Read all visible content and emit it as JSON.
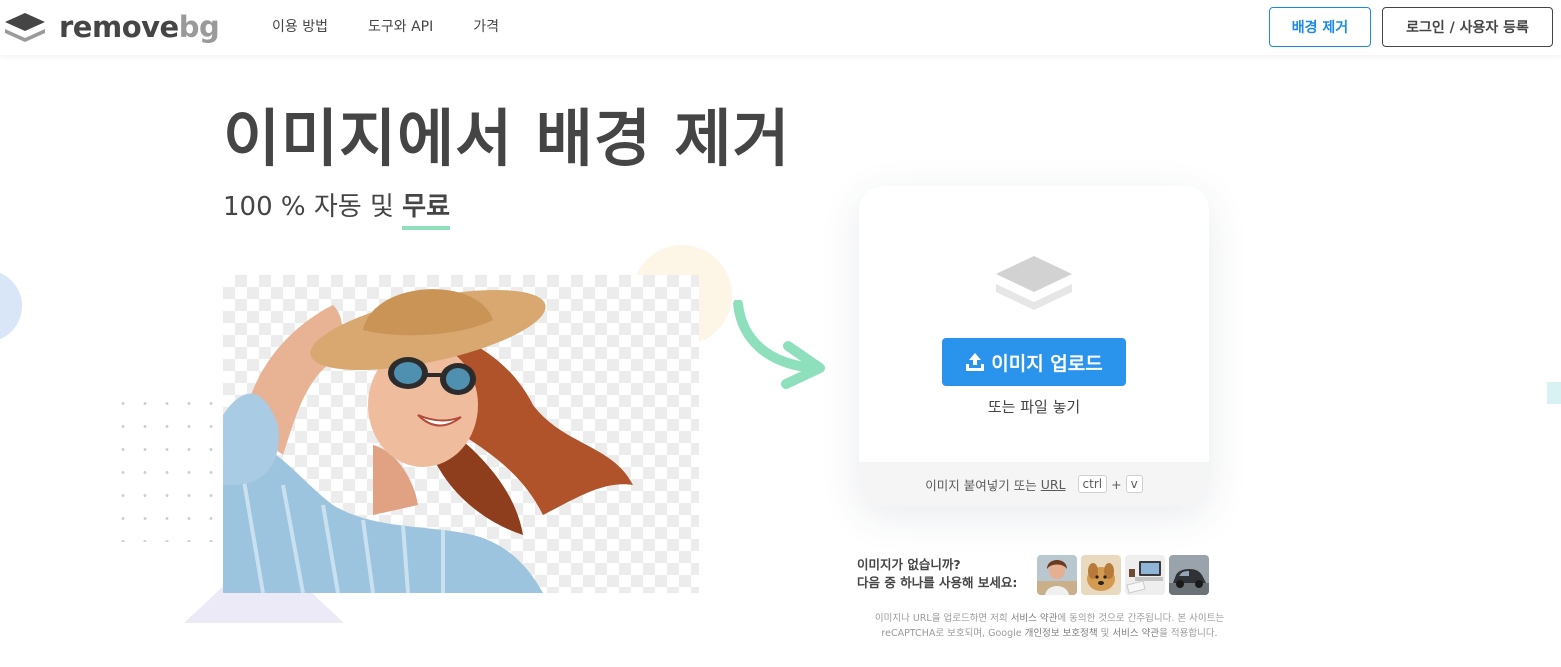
{
  "header": {
    "logo": {
      "part1": "remove",
      "part2": "bg"
    },
    "nav": [
      "이용 방법",
      "도구와 API",
      "가격"
    ],
    "remove_bg_button": "배경 제거",
    "login_button": "로그인 / 사용자 등록"
  },
  "hero": {
    "title": "이미지에서 배경 제거",
    "subtitle_prefix": "100 % 자동 및",
    "subtitle_highlight": "무료"
  },
  "upload": {
    "button_label": "이미지 업로드",
    "drop_text": "또는 파일 놓기",
    "paste_text": "이미지 붙여넣기 또는",
    "url_link": "URL",
    "key_ctrl": "ctrl",
    "key_plus": "+",
    "key_v": "v"
  },
  "samples": {
    "question_line1": "이미지가 없습니까?",
    "question_line2": "다음 중 하나를 사용해 보세요:",
    "thumbnails": [
      "woman-sample",
      "dog-sample",
      "desk-sample",
      "car-sample"
    ]
  },
  "legal": {
    "part1": "이미지나 URL을 업로드하면 저희 ",
    "terms": "서비스 약관",
    "part2": "에 동의한 것으로 간주됩니다. 본 사이트는 reCAPTCHA로 보호되며, Google ",
    "privacy": "개인정보 보호정책",
    "part3": " 및 ",
    "terms2": "서비스 약관",
    "part4": "을 적용합니다."
  },
  "colors": {
    "primary": "#2a93ec",
    "text": "#454545",
    "highlight_underline": "#8ee0bd",
    "arrow": "#8ee0bd"
  }
}
